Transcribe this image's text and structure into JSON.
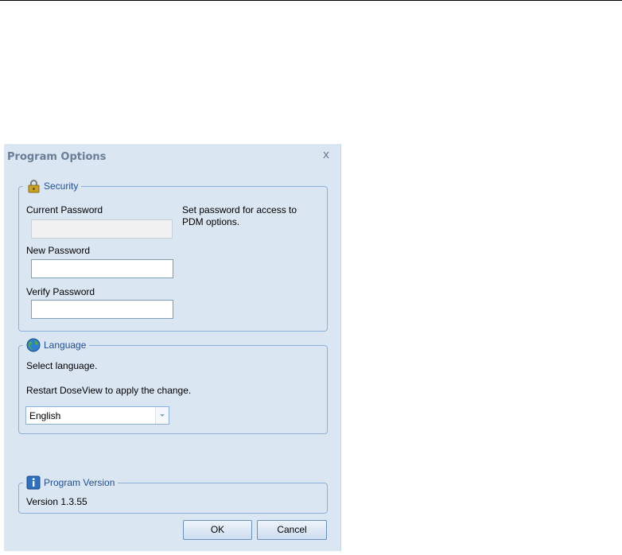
{
  "dialog": {
    "title": "Program Options",
    "close_glyph": "x"
  },
  "security": {
    "legend": "Security",
    "icon": "lock-icon",
    "current_password_label": "Current Password",
    "current_password_value": "",
    "new_password_label": "New Password",
    "new_password_value": "",
    "verify_password_label": "Verify Password",
    "verify_password_value": "",
    "hint": "Set password for access to PDM options."
  },
  "language": {
    "legend": "Language",
    "icon": "globe-icon",
    "select_text": "Select language.",
    "restart_text": "Restart DoseView to apply the change.",
    "selected": "English"
  },
  "version": {
    "legend": "Program Version",
    "icon": "info-icon",
    "text": "Version 1.3.55"
  },
  "buttons": {
    "ok": "OK",
    "cancel": "Cancel"
  },
  "colors": {
    "dialog_bg": "#dbe6f3",
    "group_border": "#8fb0d7",
    "legend_text": "#1f4e96",
    "title_text": "#6a7f97"
  }
}
